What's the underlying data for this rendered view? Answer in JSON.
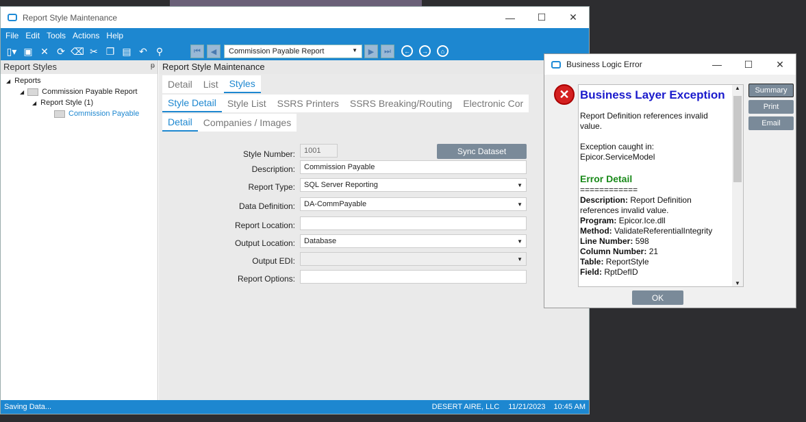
{
  "window": {
    "title": "Report Style Maintenance"
  },
  "menu": [
    "File",
    "Edit",
    "Tools",
    "Actions",
    "Help"
  ],
  "toolbar": {
    "nav_value": "Commission Payable Report"
  },
  "left_pane": {
    "title": "Report Styles",
    "tree": [
      "Reports",
      "Commission Payable Report",
      "Report Style (1)",
      "Commission Payable"
    ]
  },
  "main": {
    "title": "Report Style Maintenance",
    "tabs1": [
      "Detail",
      "List",
      "Styles"
    ],
    "tabs2": [
      "Style Detail",
      "Style List",
      "SSRS Printers",
      "SSRS Breaking/Routing",
      "Electronic Cor"
    ],
    "tabs3": [
      "Detail",
      "Companies / Images"
    ],
    "sync_button": "Sync Dataset",
    "labels": {
      "style_number": "Style Number:",
      "description": "Description:",
      "report_type": "Report Type:",
      "data_definition": "Data Definition:",
      "report_location": "Report Location:",
      "output_location": "Output Location:",
      "output_edi": "Output EDI:",
      "report_options": "Report Options:"
    },
    "values": {
      "style_number": "1001",
      "description": "Commission Payable",
      "report_type": "SQL Server Reporting",
      "data_definition": "DA-CommPayable",
      "report_location": "",
      "output_location": "Database",
      "output_edi": "",
      "report_options": ""
    }
  },
  "status": {
    "left": "Saving Data...",
    "company": "DESERT AIRE, LLC",
    "date": "11/21/2023",
    "time": "10:45 AM"
  },
  "dialog": {
    "title": "Business Logic Error",
    "heading": "Business Layer Exception",
    "message": "Report Definition references invalid value.",
    "caught_label": "Exception caught in:",
    "caught_value": "Epicor.ServiceModel",
    "detail_heading": "Error Detail",
    "separator": "============",
    "details": [
      {
        "label": "Description:",
        "value": "Report Definition references invalid value."
      },
      {
        "label": "Program:",
        "value": "Epicor.Ice.dll"
      },
      {
        "label": "Method:",
        "value": "ValidateReferentialIntegrity"
      },
      {
        "label": "Line Number:",
        "value": "598"
      },
      {
        "label": "Column Number:",
        "value": "21"
      },
      {
        "label": "Table:",
        "value": "ReportStyle"
      },
      {
        "label": "Field:",
        "value": "RptDefID"
      }
    ],
    "buttons": {
      "summary": "Summary",
      "print": "Print",
      "email": "Email",
      "ok": "OK"
    }
  }
}
